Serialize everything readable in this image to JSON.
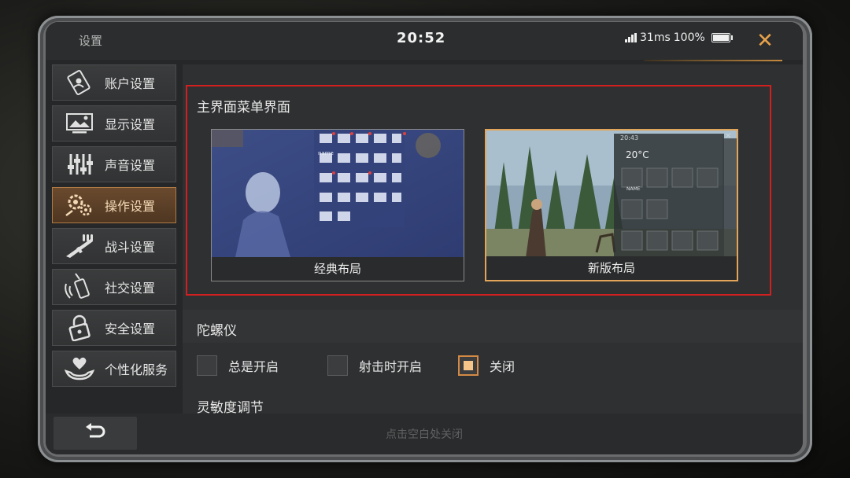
{
  "header": {
    "title": "设置",
    "time": "20:52",
    "ping": "31ms",
    "battery": "100%"
  },
  "sidebar": {
    "items": [
      {
        "label": "账户设置",
        "icon": "account-icon"
      },
      {
        "label": "显示设置",
        "icon": "display-icon"
      },
      {
        "label": "声音设置",
        "icon": "sound-icon"
      },
      {
        "label": "操作设置",
        "icon": "controls-icon",
        "active": true
      },
      {
        "label": "战斗设置",
        "icon": "combat-icon"
      },
      {
        "label": "社交设置",
        "icon": "social-icon"
      },
      {
        "label": "安全设置",
        "icon": "security-icon"
      },
      {
        "label": "个性化服务",
        "icon": "personalization-icon"
      }
    ]
  },
  "main_menu": {
    "title": "主界面菜单界面",
    "classic": {
      "label": "经典布局",
      "tile_text": "name"
    },
    "new": {
      "label": "新版布局",
      "temp": "20°C",
      "tile_text": "NAME",
      "time": "20:43"
    }
  },
  "gyro": {
    "title": "陀螺仪",
    "options": [
      {
        "label": "总是开启",
        "checked": false
      },
      {
        "label": "射击时开启",
        "checked": false
      },
      {
        "label": "关闭",
        "checked": true
      }
    ]
  },
  "sensitivity": {
    "title": "灵敏度调节"
  },
  "footer": {
    "hint": "点击空白处关闭"
  },
  "colors": {
    "accent": "#e3a55a",
    "highlight_box": "#d21f1f",
    "close": "#e8a24a"
  }
}
